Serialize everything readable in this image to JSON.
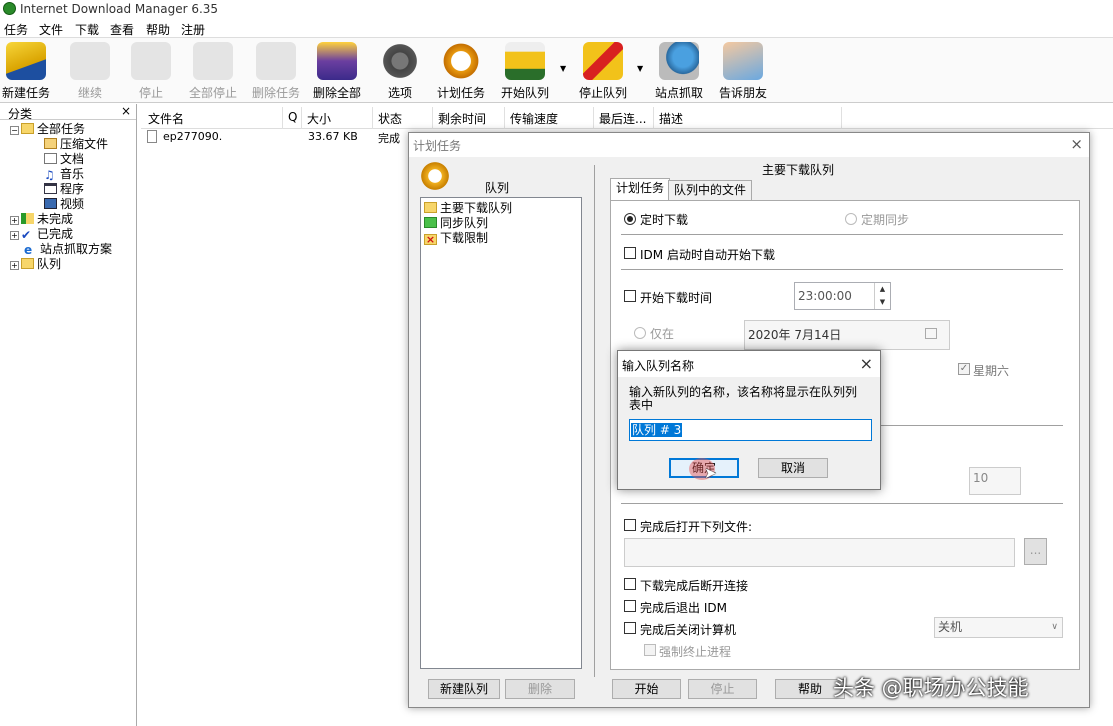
{
  "app": {
    "title": "Internet Download Manager 6.35"
  },
  "menu": [
    "任务",
    "文件",
    "下载",
    "查看",
    "帮助",
    "注册"
  ],
  "toolbar": {
    "new_task": "新建任务",
    "resume": "继续",
    "stop": "停止",
    "stop_all": "全部停止",
    "delete_task": "删除任务",
    "delete_all": "删除全部",
    "options": "选项",
    "scheduler": "计划任务",
    "start_queue": "开始队列",
    "stop_queue": "停止队列",
    "site_grabber": "站点抓取",
    "tell_friend": "告诉朋友"
  },
  "sidebar": {
    "header": "分类",
    "close": "×",
    "items": [
      "全部任务",
      "压缩文件",
      "文档",
      "音乐",
      "程序",
      "视频",
      "未完成",
      "已完成",
      "站点抓取方案",
      "队列"
    ]
  },
  "list": {
    "columns": [
      "文件名",
      "Q",
      "大小",
      "状态",
      "剩余时间",
      "传输速度",
      "最后连...",
      "描述"
    ],
    "rows": [
      {
        "name": "ep277090.",
        "size": "33.67 KB",
        "status": "完成"
      }
    ]
  },
  "scheduler": {
    "title": "计划任务",
    "close": "×",
    "queues_label": "队列",
    "queues": [
      "主要下载队列",
      "同步队列",
      "下载限制"
    ],
    "queue_heading": "主要下载队列",
    "tabs": [
      "计划任务",
      "队列中的文件"
    ],
    "one_time": "定时下载",
    "periodic": "定期同步",
    "auto_start": "IDM 启动时自动开始下载",
    "start_time_label": "开始下载时间",
    "start_time": "23:00:00",
    "only_on": "仅在",
    "date": "2020年  7月14日",
    "saturday": "星期六",
    "retries": "10",
    "open_file": "完成后打开下列文件:",
    "browse": "...",
    "hangup": "下载完成后断开连接",
    "exit_idm": "完成后退出 IDM",
    "shutdown": "完成后关闭计算机",
    "shutdown_option": "关机",
    "force": "强制终止进程",
    "new_queue": "新建队列",
    "delete": "删除",
    "start": "开始",
    "stop": "停止",
    "help": "帮助"
  },
  "prompt": {
    "title": "输入队列名称",
    "close": "×",
    "message": "输入新队列的名称，该名称将显示在队列列表中",
    "value": "队列 # 3",
    "ok": "确定",
    "cancel": "取消"
  },
  "watermark": "头条 @职场办公技能"
}
